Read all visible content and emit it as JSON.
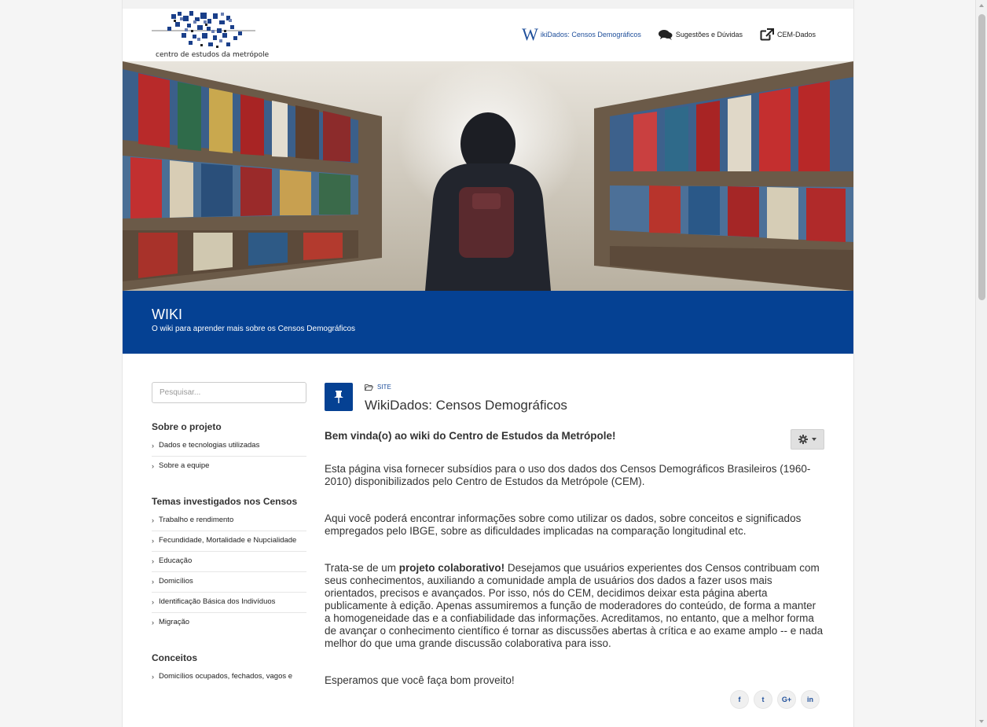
{
  "header": {
    "logo_text": "centro de estudos da metrópole",
    "nav": [
      {
        "label": "ikiDados: Censos Demográficos",
        "icon": "wikipedia-w-icon",
        "glyph": "W",
        "active": true
      },
      {
        "label": "Sugestões e Dúvidas",
        "icon": "comments-icon",
        "active": false
      },
      {
        "label": "CEM-Dados",
        "icon": "external-link-icon",
        "active": false
      }
    ]
  },
  "banner": {
    "title": "WIKI",
    "subtitle": "O wiki para aprender mais sobre os Censos Demográficos",
    "color": "#054193"
  },
  "sidebar": {
    "search_placeholder": "Pesquisar...",
    "sections": [
      {
        "heading": "Sobre o projeto",
        "items": [
          "Dados e tecnologias utilizadas",
          "Sobre a equipe"
        ]
      },
      {
        "heading": "Temas investigados nos Censos",
        "items": [
          "Trabalho e rendimento",
          "Fecundidade, Mortalidade e Nupcialidade",
          "Educação",
          "Domicílios",
          "Identificação Básica dos Indivíduos",
          "Migração"
        ]
      },
      {
        "heading": "Conceitos",
        "items": [
          "Domicílios ocupados, fechados, vagos e"
        ]
      }
    ]
  },
  "main": {
    "breadcrumb": "SITE",
    "title": "WikiDados: Censos Demográficos",
    "heading": "Bem vinda(o) ao wiki do Centro de Estudos da Metrópole!",
    "p1": "Esta página visa fornecer subsídios para o uso dos dados dos Censos Demográficos Brasileiros (1960-2010) disponibilizados pelo Centro de Estudos da Metrópole (CEM).",
    "p2": "Aqui você poderá encontrar informações sobre como utilizar os dados, sobre conceitos e significados empregados pelo IBGE, sobre as dificuldades implicadas na comparação longitudinal etc.",
    "p3_pre": "Trata-se de um ",
    "p3_bold": "projeto colaborativo!",
    "p3_post": " Desejamos que usuários experientes dos Censos contribuam com seus conhecimentos, auxiliando a comunidade ampla de usuários dos dados a fazer usos mais orientados, precisos e avançados. Por isso, nós do CEM, decidimos deixar esta página aberta publicamente à edição. Apenas assumiremos a função de moderadores do conteúdo, de forma a manter a homogeneidade das e a confiabilidade das informações. Acreditamos, no entanto, que a melhor forma de avançar o conhecimento científico é tornar as discussões abertas à crítica e ao exame amplo -- e nada melhor do que uma grande discussão colaborativa para isso.",
    "p4": "Esperamos que você faça bom proveito!",
    "share": [
      {
        "icon": "facebook-icon",
        "glyph": "f"
      },
      {
        "icon": "twitter-icon",
        "glyph": "t"
      },
      {
        "icon": "google-plus-icon",
        "glyph": "G+"
      },
      {
        "icon": "linkedin-icon",
        "glyph": "in"
      }
    ]
  }
}
